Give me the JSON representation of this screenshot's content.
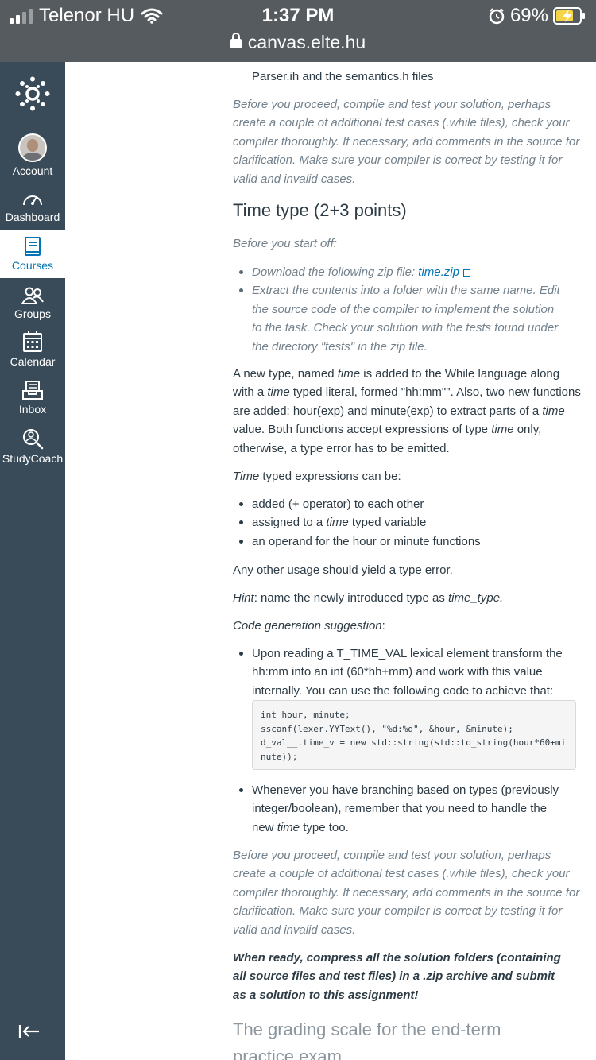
{
  "status_bar": {
    "carrier": "Telenor HU",
    "time": "1:37 PM",
    "battery": "69%",
    "url": "canvas.elte.hu"
  },
  "sidebar": {
    "items": [
      {
        "label": "Account",
        "icon": "avatar"
      },
      {
        "label": "Dashboard",
        "icon": "dashboard-icon"
      },
      {
        "label": "Courses",
        "icon": "courses-icon"
      },
      {
        "label": "Groups",
        "icon": "groups-icon"
      },
      {
        "label": "Calendar",
        "icon": "calendar-icon"
      },
      {
        "label": "Inbox",
        "icon": "inbox-icon"
      },
      {
        "label": "StudyCoach",
        "icon": "studycoach-icon"
      }
    ],
    "accent": "#0374b5",
    "background": "#394b58"
  },
  "content": {
    "top_fragment": "Parser.ih and the semantics.h files",
    "proceed_note_1": "Before you proceed, compile and test your solution, perhaps create a couple of additional test cases (.while files), check your compiler thoroughly. If necessary, add comments in the source for clarification. Make sure your compiler is correct by testing it for valid and invalid cases.",
    "section_title": "Time type (2+3 points)",
    "before_start": "Before you start off:",
    "download_prefix": "Download the following zip file: ",
    "download_link": "time.zip",
    "extract_text": "Extract the contents into a folder with the same name. Edit the source code of the compiler to implement the solution to the task. Check your solution with the tests found under the directory \"tests\" in the zip file.",
    "para_intro": {
      "t1": "A new type, named ",
      "em1": "time",
      "t2": " is added to the While language along with a ",
      "em2": "time",
      "t3": " typed literal, formed \"hh:mm\"\". Also, two new functions are added: hour(exp) and minute(exp) to extract parts of a ",
      "em3": "time",
      "t4": " value. Both functions accept expressions of type ",
      "em4": "time",
      "t5": " only, otherwise, a type error has to be emitted."
    },
    "typed_expr": {
      "em": "Time",
      "rest": " typed expressions can be:"
    },
    "usage_items": {
      "i1": "added (+ operator) to each other",
      "i2_pre": "assigned to a ",
      "i2_em": "time",
      "i2_post": " typed variable",
      "i3": "an operand for the hour or minute functions"
    },
    "other_usage": "Any other usage should yield a type error.",
    "hint": {
      "em": "Hint",
      "rest": ": name the newly introduced type as ",
      "em2": "time_type."
    },
    "code_gen": "Code generation suggestion",
    "code_gen_colon": ":",
    "suggestion_1": "Upon reading a T_TIME_VAL lexical element transform the hh:mm into an int (60*hh+mm) and work with this value internally. You can use the following code to achieve that:",
    "code_lines": [
      "int hour, minute;",
      "sscanf(lexer.YYText(), \"%d:%d\", &hour, &minute);",
      "d_val__.time_v = new std::string(std::to_string(hour*60+minute));"
    ],
    "suggestion_2": {
      "pre": "Whenever you have branching based on types (previously integer/boolean), remember that you need to handle the new ",
      "em": "time",
      "post": " type too."
    },
    "proceed_note_2": "Before you proceed, compile and test your solution, perhaps create a couple of additional test cases (.while files), check your compiler thoroughly. If necessary, add comments in the source for clarification. Make sure your compiler is correct by testing it for valid and invalid cases.",
    "submit_note": "When ready, compress all the solution folders (containing all source files and test files) in a .zip archive and submit as a solution to this assignment!",
    "next_title": "The grading scale for the end-term practice exam"
  }
}
